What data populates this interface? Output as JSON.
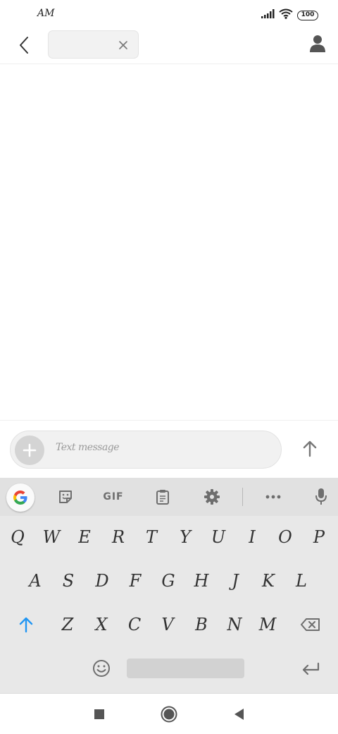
{
  "status_bar": {
    "time": "AM",
    "battery": "100"
  },
  "top_bar": {
    "recipient": ""
  },
  "compose": {
    "placeholder": "Text message"
  },
  "keyboard": {
    "toolbar": {
      "gif_label": "GIF"
    },
    "row1": [
      "Q",
      "W",
      "E",
      "R",
      "T",
      "Y",
      "U",
      "I",
      "O",
      "P"
    ],
    "row2": [
      "A",
      "S",
      "D",
      "F",
      "G",
      "H",
      "J",
      "K",
      "L"
    ],
    "row3": [
      "Z",
      "X",
      "C",
      "V",
      "B",
      "N",
      "M"
    ]
  },
  "colors": {
    "shift_accent": "#2196f3",
    "icon_gray": "#6e6e6e"
  }
}
